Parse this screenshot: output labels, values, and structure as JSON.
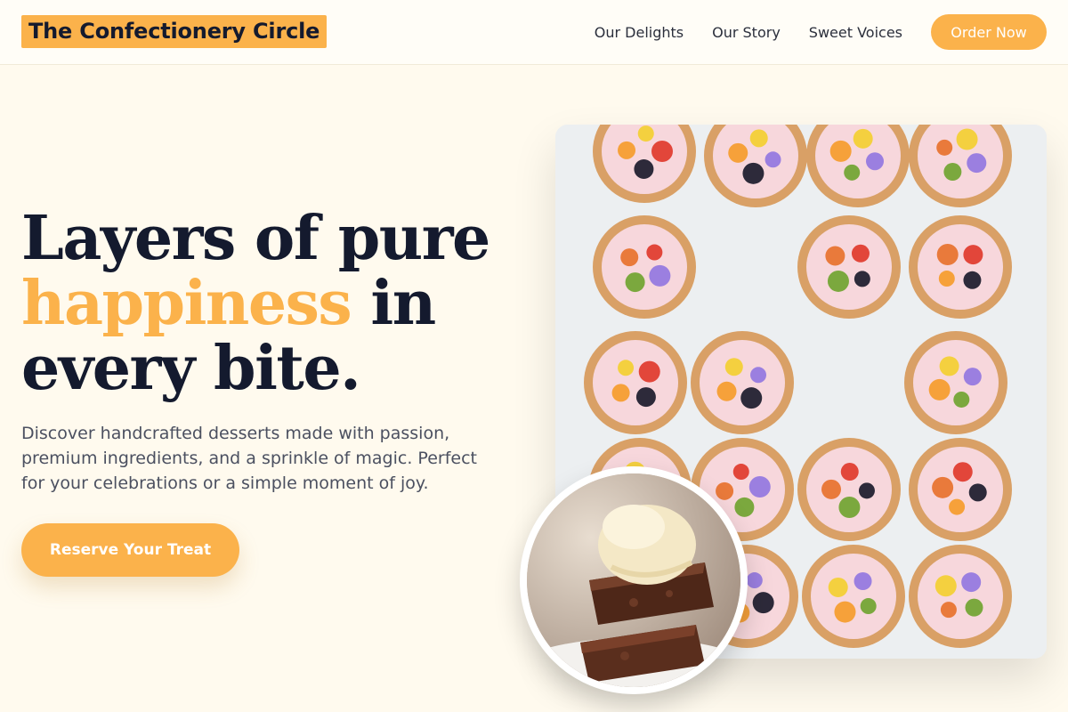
{
  "header": {
    "logo": "The Confectionery Circle",
    "nav": [
      "Our Delights",
      "Our Story",
      "Sweet Voices"
    ],
    "order_label": "Order Now"
  },
  "hero": {
    "headline_line1": "Layers of pure",
    "headline_accent": "happiness",
    "headline_line2_rest": " in",
    "headline_line3": "every bite.",
    "lede": "Discover handcrafted desserts made with passion, premium ingredients, and a sprinkle of magic. Perfect for your celebrations or a simple moment of joy.",
    "cta_label": "Reserve Your Treat"
  },
  "images": {
    "main": "fruit-tartlets-photo",
    "circle": "brownie-ice-cream-photo"
  },
  "colors": {
    "accent": "#fbb24b",
    "background": "#fffaee",
    "heading": "#141a2e"
  }
}
